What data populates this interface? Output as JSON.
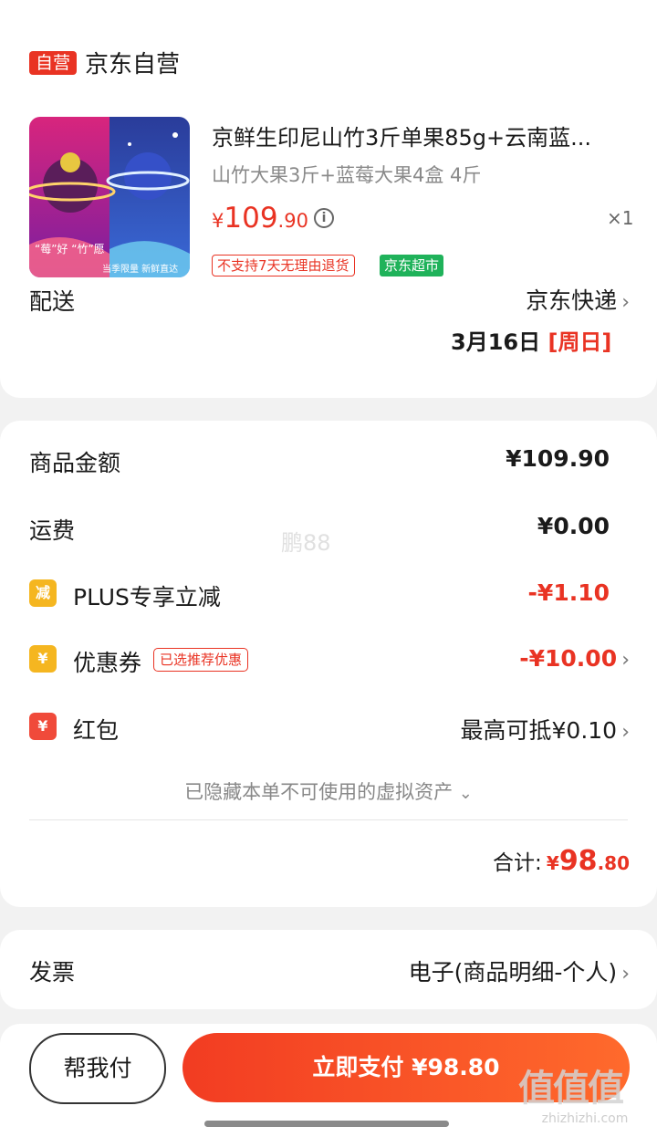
{
  "shop": {
    "badge": "自营",
    "name": "京东自营"
  },
  "product": {
    "title": "京鲜生印尼山竹3斤单果85g+云南蓝...",
    "spec": "山竹大果3斤+蓝莓大果4盒 4斤",
    "price_symbol": "¥",
    "price_int": "109",
    "price_dec": ".90",
    "qty": "×1",
    "tag_return": "不支持7天无理由退货",
    "tag_market": "京东超市",
    "thumb_text_left": "“莓”好 “竹”愿",
    "thumb_text_right": "当季限量 新鲜直达"
  },
  "delivery": {
    "label": "配送",
    "method": "京东快递",
    "date": "3月16日",
    "weekday": "[周日]"
  },
  "summary": {
    "goods_label": "商品金额",
    "goods_value": "¥109.90",
    "freight_label": "运费",
    "freight_value": "¥0.00",
    "plus_icon": "减",
    "plus_label": "PLUS专享立减",
    "plus_value": "-¥1.10",
    "coupon_icon": "¥",
    "coupon_label": "优惠券",
    "coupon_tag": "已选推荐优惠",
    "coupon_value": "-¥10.00",
    "redpack_icon": "¥",
    "redpack_label": "红包",
    "redpack_value": "最高可抵¥0.10",
    "hidden_note": "已隐藏本单不可使用的虚拟资产",
    "total_label": "合计:",
    "total_symbol": "¥",
    "total_int": "98",
    "total_dec": ".80"
  },
  "invoice": {
    "label": "发票",
    "value": "电子(商品明细-个人)"
  },
  "footer": {
    "help_label": "帮我付",
    "pay_label": "立即支付 ¥98.80"
  },
  "watermark": "鹏88",
  "site_watermark": {
    "logo": "值值值",
    "url": "zhizhizhi.com"
  },
  "colors": {
    "accent": "#e93323",
    "green_tag": "#1fb25a",
    "pay_start": "#f23c22",
    "pay_end": "#ff6a2c"
  }
}
